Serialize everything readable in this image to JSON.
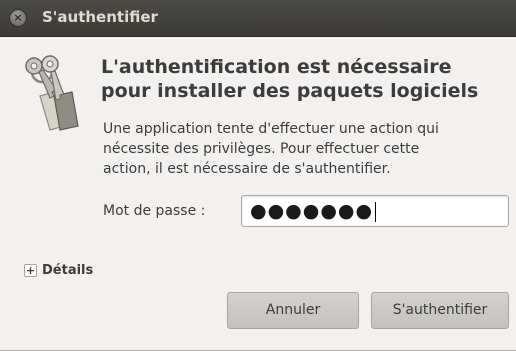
{
  "window": {
    "title": "S'authentifier"
  },
  "dialog": {
    "icon": "keys-icon",
    "heading_line1": "L'authentification est nécessaire",
    "heading_line2": "pour installer des paquets logiciels",
    "body_line1": "Une application tente d'effectuer une action qui",
    "body_line2": "nécessite des privilèges. Pour effectuer cette",
    "body_line3": "action, il est nécessaire de s'authentifier.",
    "password_label": "Mot de passe :",
    "password_value": "●●●●●●●",
    "details_expander": "Détails",
    "details_toggle": "+",
    "cancel_button": "Annuler",
    "authenticate_button": "S'authentifier"
  }
}
